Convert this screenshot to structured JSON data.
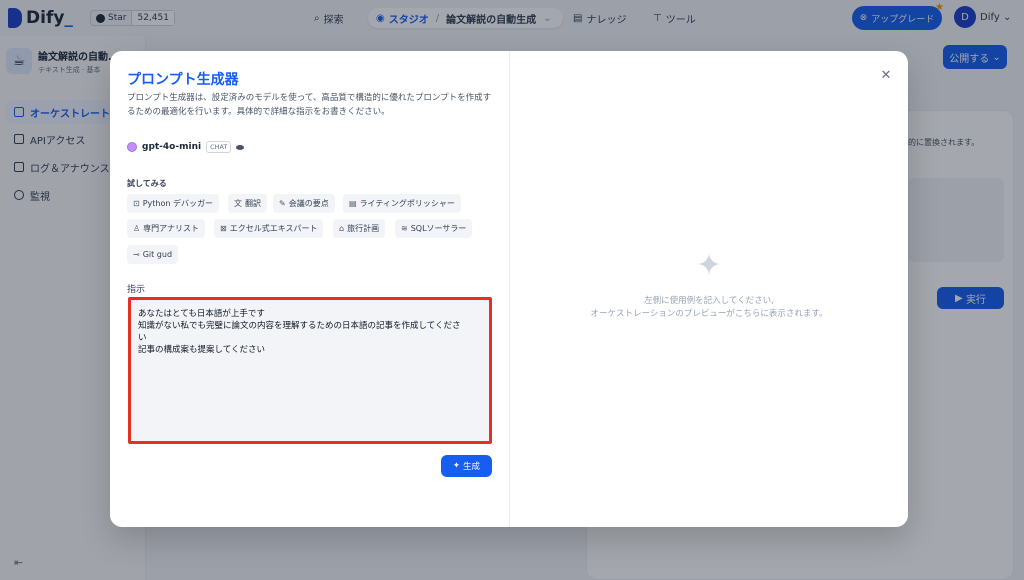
{
  "topbar": {
    "logo": "Dify",
    "logo_suffix": "_",
    "github_star_label": "Star",
    "github_star_count": "52,451",
    "nav_explore": "探索",
    "nav_studio": "スタジオ",
    "nav_app_crumb": "論文解説の自動生成",
    "nav_knowledge": "ナレッジ",
    "nav_tools": "ツール",
    "upgrade_label": "アップグレード",
    "avatar_initial": "D",
    "user_name": "Dify"
  },
  "sidebar": {
    "app_name": "論文解説の自動...",
    "app_type": "テキスト生成 · 基本",
    "items": [
      {
        "label": "オーケストレート",
        "icon": "orchestrate-icon"
      },
      {
        "label": "APIアクセス",
        "icon": "api-icon"
      },
      {
        "label": "ログ＆アナウンス",
        "icon": "log-icon"
      },
      {
        "label": "監視",
        "icon": "monitor-icon"
      }
    ]
  },
  "background": {
    "publish_label": "公開する",
    "run_label": "実行",
    "note": "的に置換されます。"
  },
  "modal": {
    "title": "プロンプト生成器",
    "description": "プロンプト生成器は、設定済みのモデルを使って、高品質で構造的に優れたプロンプトを作成するための最適化を行います。具体的で詳細な指示をお書きください。",
    "model_name": "gpt-4o-mini",
    "model_tag": "CHAT",
    "try_label": "試してみる",
    "chips": [
      {
        "label": "Python デバッガー",
        "icon": "terminal-icon"
      },
      {
        "label": "翻訳",
        "icon": "translate-icon"
      },
      {
        "label": "会議の要点",
        "icon": "meeting-icon"
      },
      {
        "label": "ライティングポリッシャー",
        "icon": "writing-icon"
      },
      {
        "label": "専門アナリスト",
        "icon": "analyst-icon"
      },
      {
        "label": "エクセル式エキスパート",
        "icon": "excel-icon"
      },
      {
        "label": "旅行計画",
        "icon": "travel-icon"
      },
      {
        "label": "SQLソーサラー",
        "icon": "database-icon"
      },
      {
        "label": "Git gud",
        "icon": "git-icon"
      }
    ],
    "instruction_label": "指示",
    "instruction_text": "あなたはとても日本語が上手です\n知識がない私でも完璧に論文の内容を理解するための日本語の記事を作成してくださ\nい\n記事の構成案も提案してください",
    "generate_label": "生成",
    "empty_line1": "左側に使用例を記入してください,",
    "empty_line2": "オーケストレーションのプレビューがこちらに表示されます。"
  },
  "colors": {
    "accent": "#155eef",
    "highlight_border": "#e53020"
  }
}
